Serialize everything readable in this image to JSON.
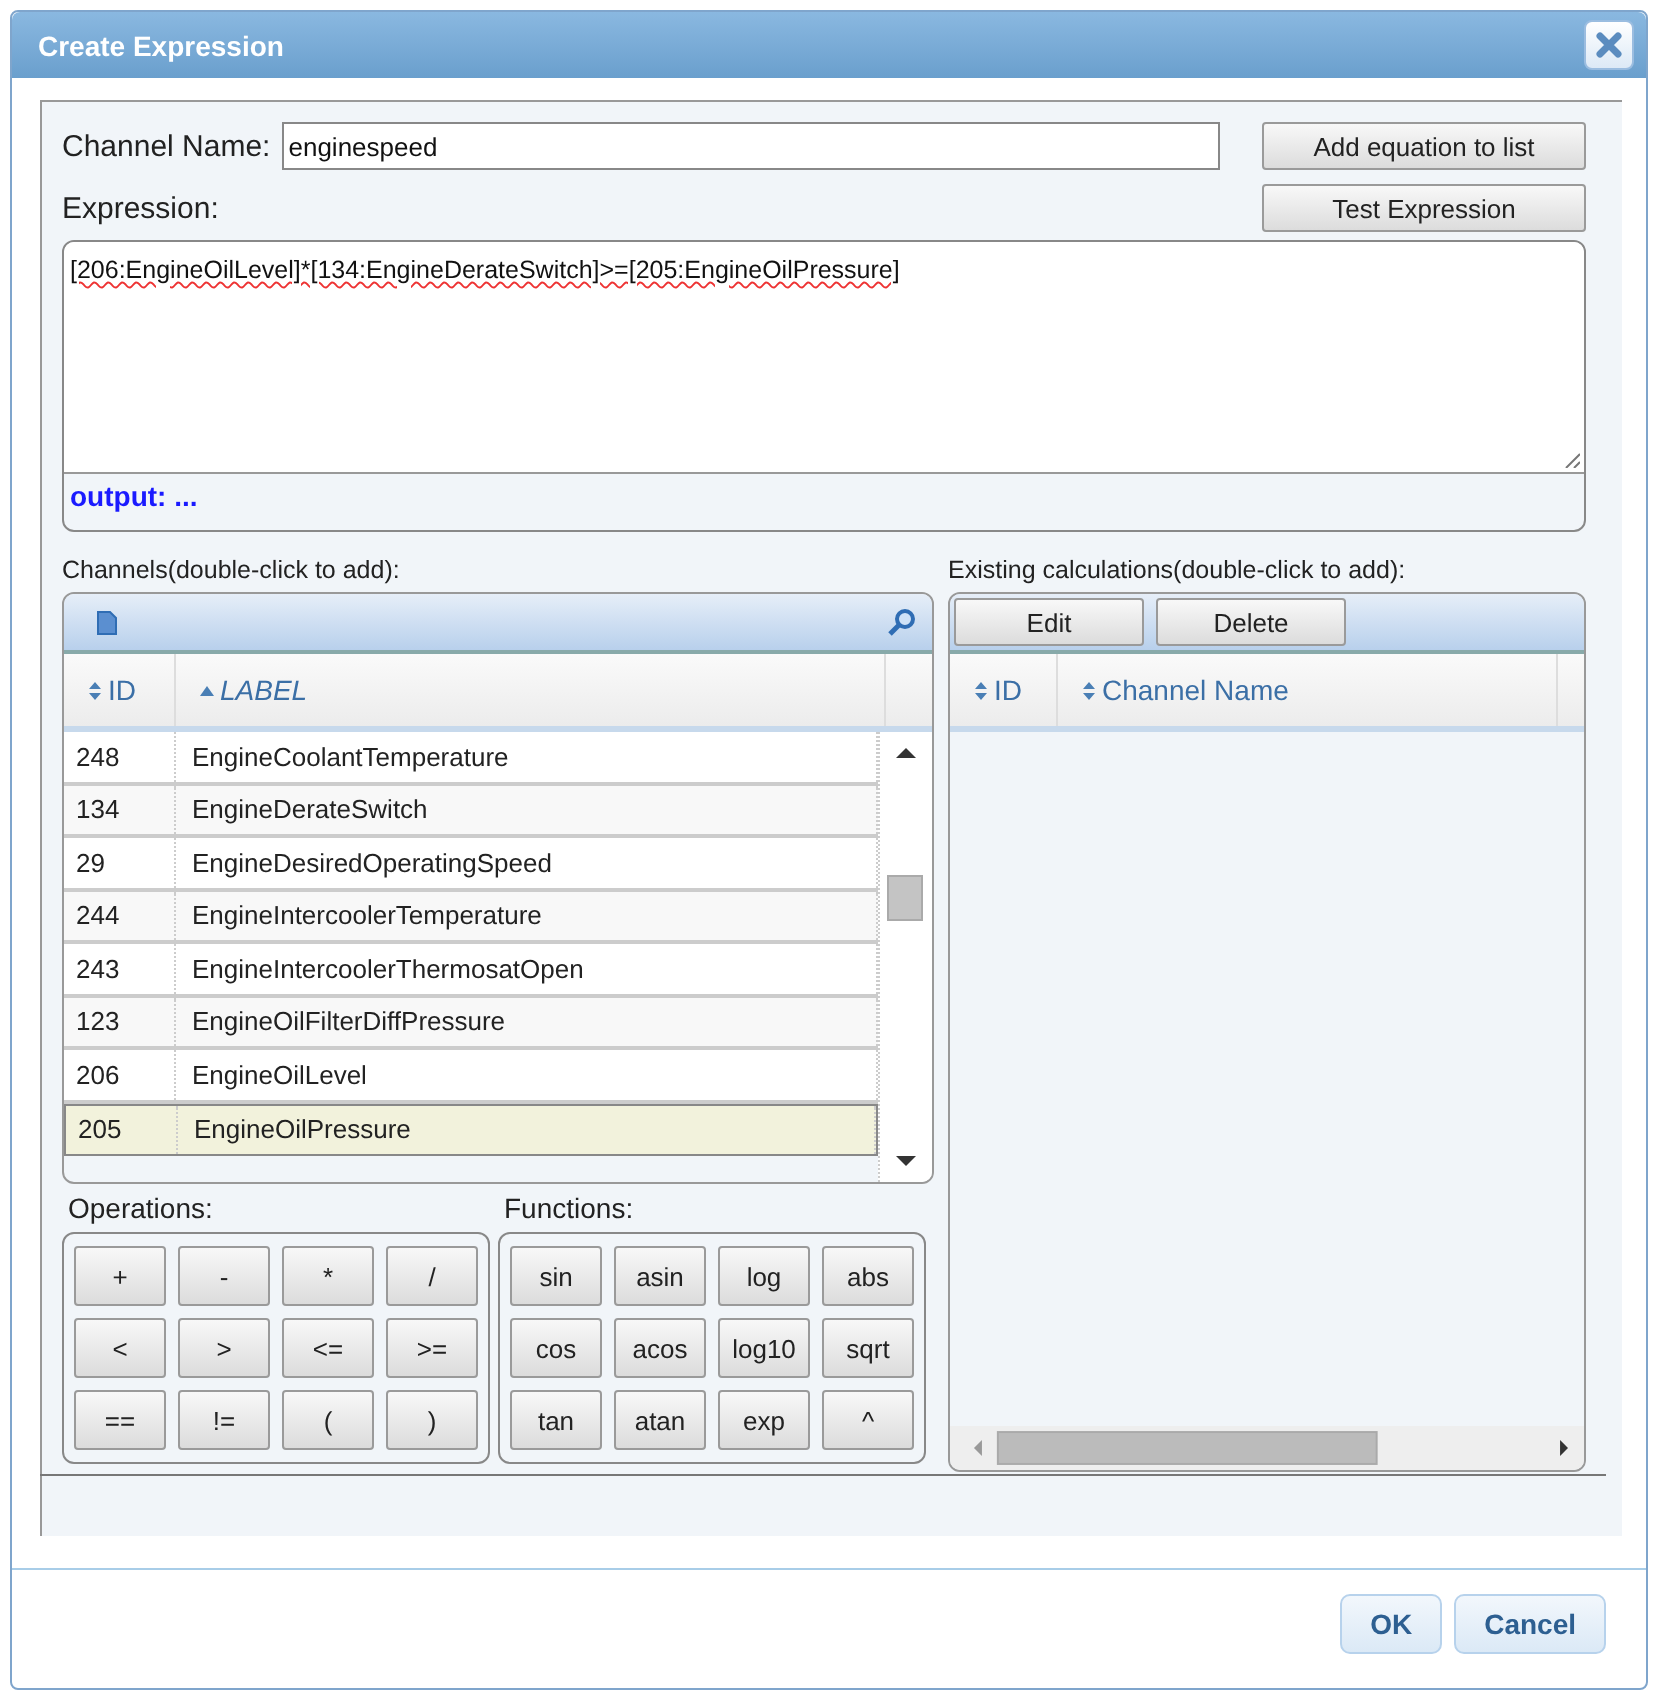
{
  "dialog": {
    "title": "Create Expression"
  },
  "channel_name": {
    "label": "Channel Name:",
    "value": "enginespeed"
  },
  "side_buttons": [
    "Add equation to list",
    "Test Expression"
  ],
  "expression": {
    "label": "Expression:",
    "value": "[206:EngineOilLevel]*[134:EngineDerateSwitch]>=[205:EngineOilPressure]",
    "output": "output: ..."
  },
  "channels": {
    "caption": "Channels(double-click to add):",
    "columns": [
      {
        "label": "ID",
        "sorted": false
      },
      {
        "label": "LABEL",
        "sorted": true
      }
    ],
    "rows": [
      {
        "id": "248",
        "label": "EngineCoolantTemperature",
        "selected": false
      },
      {
        "id": "134",
        "label": "EngineDerateSwitch",
        "selected": false
      },
      {
        "id": "29",
        "label": "EngineDesiredOperatingSpeed",
        "selected": false
      },
      {
        "id": "244",
        "label": "EngineIntercoolerTemperature",
        "selected": false
      },
      {
        "id": "243",
        "label": "EngineIntercoolerThermosatOpen",
        "selected": false
      },
      {
        "id": "123",
        "label": "EngineOilFilterDiffPressure",
        "selected": false
      },
      {
        "id": "206",
        "label": "EngineOilLevel",
        "selected": false
      },
      {
        "id": "205",
        "label": "EngineOilPressure",
        "selected": true
      }
    ]
  },
  "operations": {
    "caption": "Operations:",
    "keys": [
      "+",
      "-",
      "*",
      "/",
      "<",
      ">",
      "<=",
      ">=",
      "==",
      "!=",
      "(",
      ")"
    ]
  },
  "functions": {
    "caption": "Functions:",
    "keys": [
      "sin",
      "asin",
      "log",
      "abs",
      "cos",
      "acos",
      "log10",
      "sqrt",
      "tan",
      "atan",
      "exp",
      "^"
    ]
  },
  "calculations": {
    "caption": "Existing calculations(double-click to add):",
    "toolbar": [
      "Edit",
      "Delete"
    ],
    "columns": [
      {
        "label": "ID",
        "sorted": false
      },
      {
        "label": "Channel Name",
        "sorted": false
      }
    ]
  },
  "footer": [
    "OK",
    "Cancel"
  ]
}
